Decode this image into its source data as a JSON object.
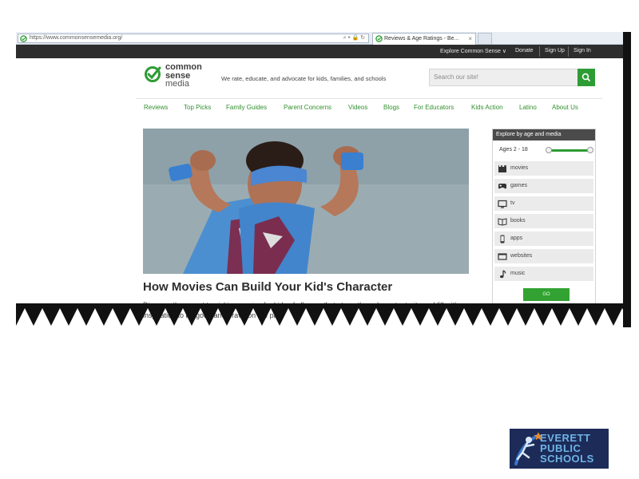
{
  "browser": {
    "address_url": "https://www.commonsensemedia.org/",
    "tab_title": "Reviews & Age Ratings - Be...",
    "tab_close": "×"
  },
  "topbar": {
    "explore": "Explore Common Sense ∨",
    "donate": "Donate",
    "signup": "Sign Up",
    "signin": "Sign In"
  },
  "brand": {
    "line1": "common",
    "line2": "sense",
    "line3": "media",
    "tagline": "We rate, educate, and advocate for kids, families, and schools",
    "accent": "#2e9c34"
  },
  "search": {
    "placeholder": "Search our site!"
  },
  "nav": {
    "items": [
      "Reviews",
      "Top Picks",
      "Family Guides",
      "Parent Concerns",
      "Videos",
      "Blogs",
      "For Educators",
      "Kids Action",
      "Latino",
      "About Us"
    ]
  },
  "feature": {
    "headline": "How Movies Can Build Your Kid's Character",
    "description": "Discover the secret to picking movies for kids of all ages that strengthen character traits and fill with inspiration to be good and brave on the path"
  },
  "explore": {
    "title": "Explore by age and media",
    "ages_label": "Ages 2 - 18",
    "media": [
      {
        "label": "movies",
        "icon": "film-icon"
      },
      {
        "label": "games",
        "icon": "gamepad-icon"
      },
      {
        "label": "tv",
        "icon": "tv-icon"
      },
      {
        "label": "books",
        "icon": "book-icon"
      },
      {
        "label": "apps",
        "icon": "phone-icon"
      },
      {
        "label": "websites",
        "icon": "monitor-icon"
      },
      {
        "label": "music",
        "icon": "music-note-icon"
      }
    ],
    "go_label": "GO"
  },
  "school_logo": {
    "line1": "EVERETT",
    "line2": "PUBLIC",
    "line3": "SCHOOLS"
  }
}
